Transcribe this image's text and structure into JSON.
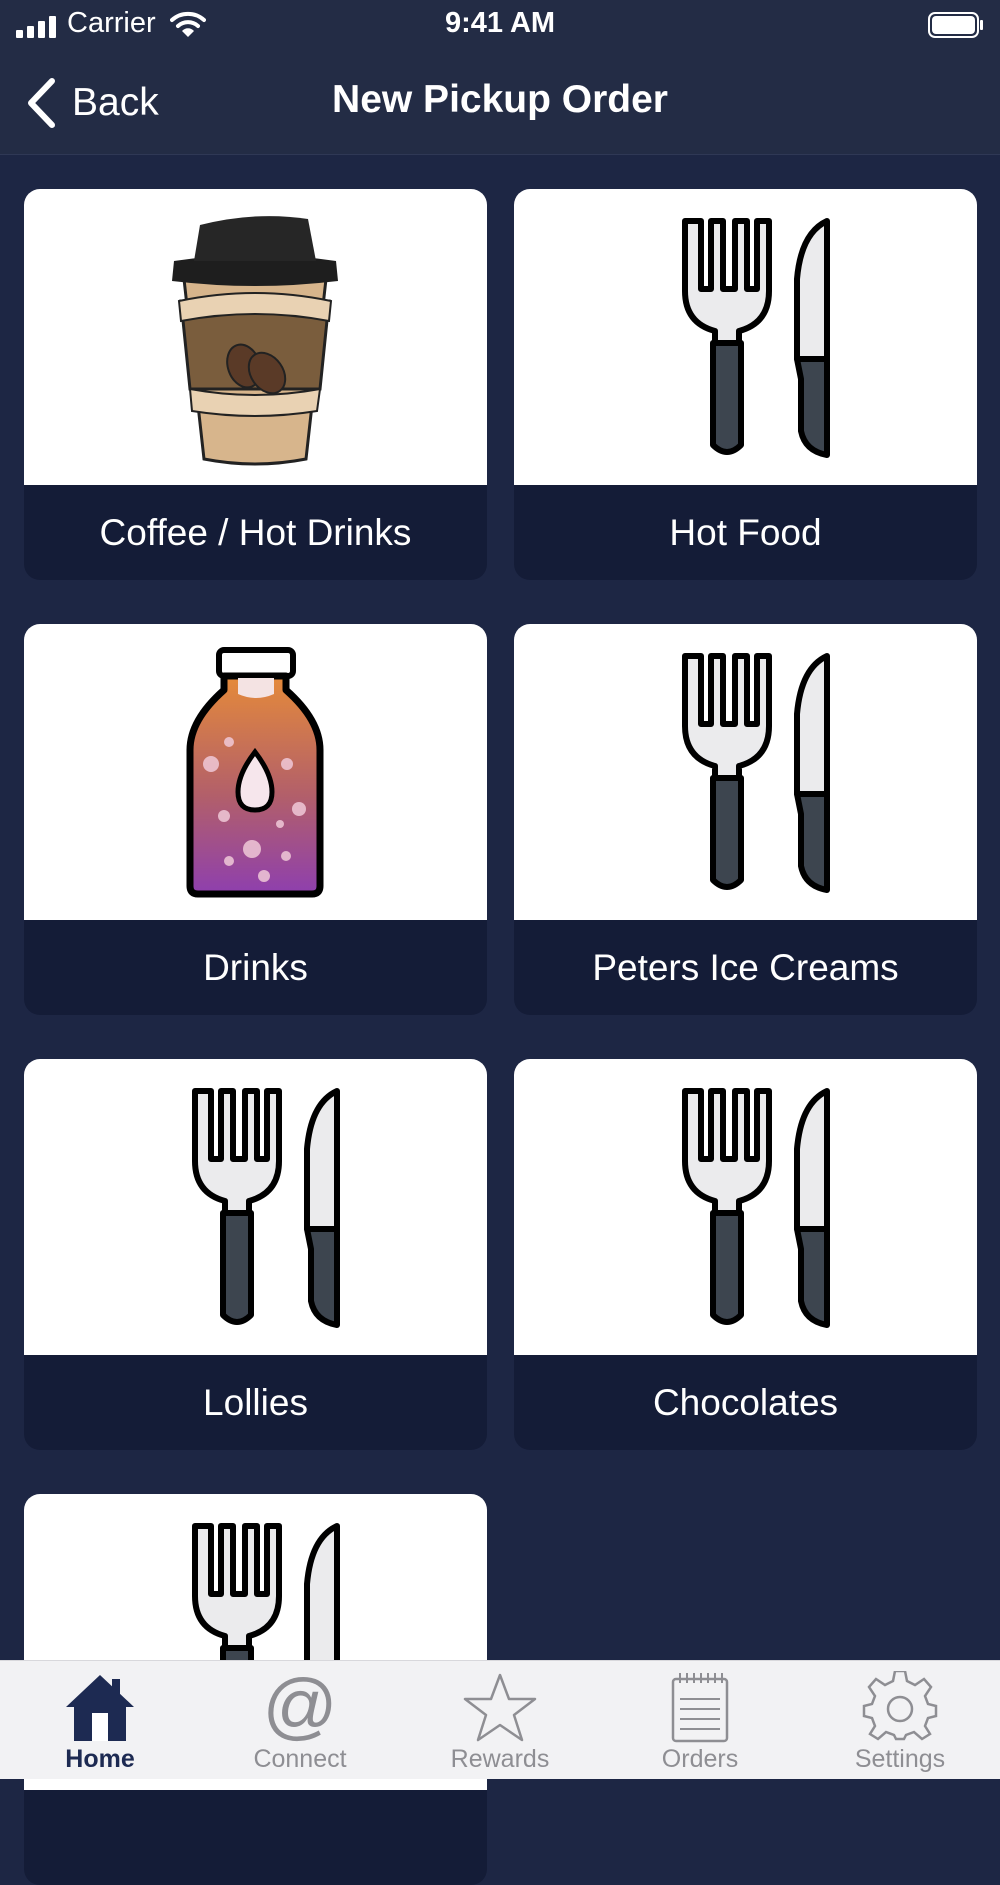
{
  "status_bar": {
    "carrier": "Carrier",
    "time": "9:41 AM"
  },
  "nav": {
    "back_label": "Back",
    "title": "New Pickup Order"
  },
  "categories": [
    {
      "label": "Coffee / Hot Drinks",
      "icon": "coffee-cup-icon"
    },
    {
      "label": "Hot Food",
      "icon": "cutlery-icon"
    },
    {
      "label": "Drinks",
      "icon": "bottle-icon"
    },
    {
      "label": "Peters Ice Creams",
      "icon": "cutlery-icon"
    },
    {
      "label": "Lollies",
      "icon": "cutlery-icon"
    },
    {
      "label": "Chocolates",
      "icon": "cutlery-icon"
    },
    {
      "label": "",
      "icon": "cutlery-icon"
    }
  ],
  "tab_bar": {
    "tabs": [
      {
        "label": "Home",
        "icon": "home-icon",
        "active": true
      },
      {
        "label": "Connect",
        "icon": "at-icon"
      },
      {
        "label": "Rewards",
        "icon": "star-icon"
      },
      {
        "label": "Orders",
        "icon": "notepad-icon"
      },
      {
        "label": "Settings",
        "icon": "gear-icon"
      }
    ]
  },
  "colors": {
    "background": "#1d2644",
    "bar": "#232c45",
    "tile_label_bg": "#141c37",
    "tab_active": "#1d2a52",
    "tab_inactive": "#8e8e93"
  }
}
